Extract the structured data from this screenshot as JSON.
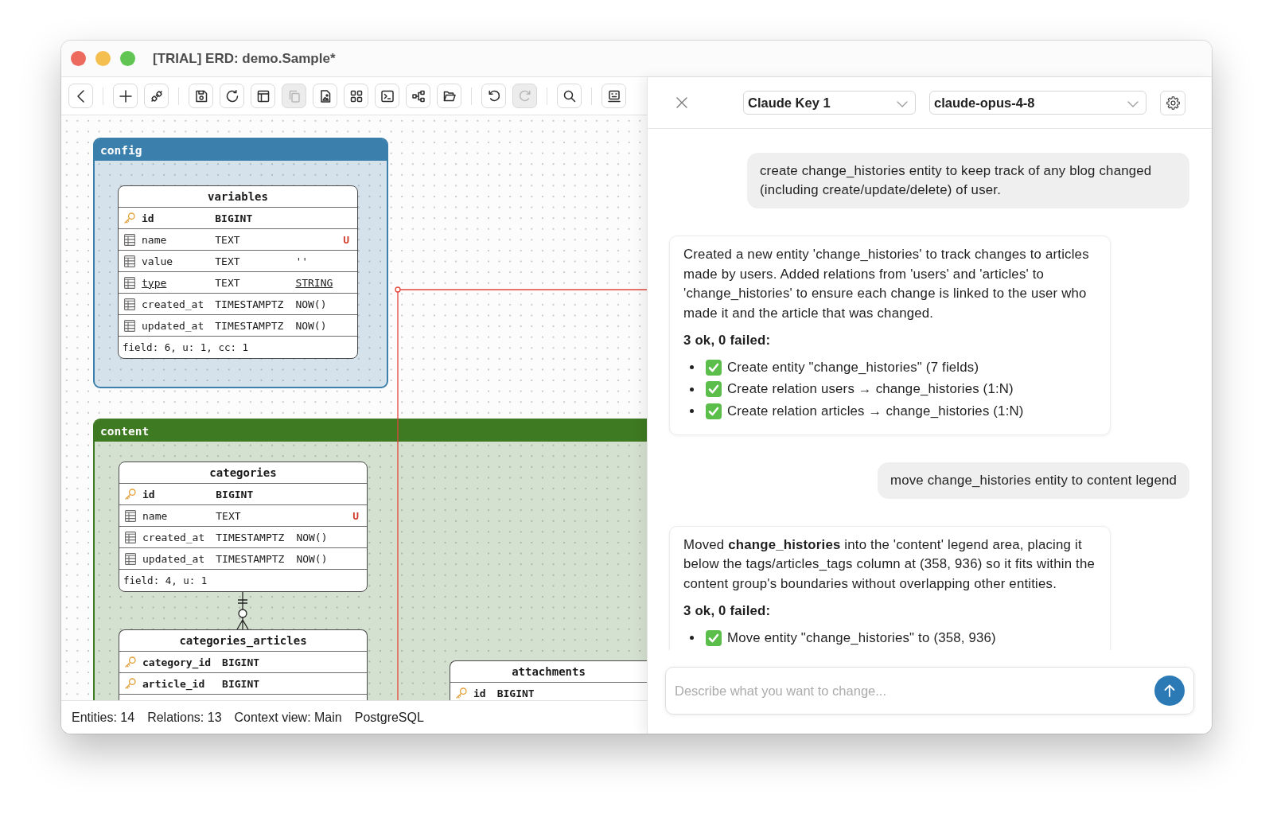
{
  "window": {
    "title": "[TRIAL] ERD: demo.Sample*"
  },
  "toolbar": {
    "groups": [
      {
        "items": [
          {
            "kind": "back",
            "disabled": false
          }
        ]
      },
      {
        "items": [
          {
            "kind": "add",
            "disabled": false
          },
          {
            "kind": "connect",
            "disabled": false
          }
        ]
      },
      {
        "items": [
          {
            "kind": "save",
            "disabled": false
          },
          {
            "kind": "refresh",
            "disabled": false
          },
          {
            "kind": "layout",
            "disabled": false
          },
          {
            "kind": "copy",
            "disabled": true
          },
          {
            "kind": "image",
            "disabled": false
          },
          {
            "kind": "grid",
            "disabled": false
          },
          {
            "kind": "terminal",
            "disabled": false
          },
          {
            "kind": "diagram",
            "disabled": false
          },
          {
            "kind": "folder",
            "disabled": false
          }
        ]
      },
      {
        "items": [
          {
            "kind": "undo",
            "disabled": false
          },
          {
            "kind": "redo",
            "disabled": true
          }
        ]
      },
      {
        "items": [
          {
            "kind": "search",
            "disabled": false
          }
        ]
      },
      {
        "items": [
          {
            "kind": "screen",
            "disabled": false
          }
        ]
      }
    ]
  },
  "canvas": {
    "groups": [
      {
        "name": "config",
        "color": "#3b7fac",
        "tables": [
          {
            "name": "variables",
            "fields": [
              {
                "kind": "primary",
                "name": "id",
                "type": "BIGINT",
                "underlined": false
              },
              {
                "kind": "column",
                "name": "name",
                "type": "TEXT",
                "flag": "U",
                "underlined": false
              },
              {
                "kind": "column",
                "name": "value",
                "type": "TEXT",
                "default": "''",
                "underlined": false
              },
              {
                "kind": "column",
                "name": "type",
                "type": "TEXT",
                "default": "STRING",
                "underlined": true
              },
              {
                "kind": "column",
                "name": "created_at",
                "type": "TIMESTAMPTZ",
                "default": "NOW()",
                "underlined": false
              },
              {
                "kind": "column",
                "name": "updated_at",
                "type": "TIMESTAMPTZ",
                "default": "NOW()",
                "underlined": false
              }
            ],
            "footer": "field: 6, u: 1, cc: 1"
          }
        ]
      },
      {
        "name": "content",
        "color": "#3e7a22",
        "tables": [
          {
            "name": "categories",
            "fields": [
              {
                "kind": "primary",
                "name": "id",
                "type": "BIGINT",
                "underlined": false
              },
              {
                "kind": "column",
                "name": "name",
                "type": "TEXT",
                "flag": "U",
                "underlined": false
              },
              {
                "kind": "column",
                "name": "created_at",
                "type": "TIMESTAMPTZ",
                "default": "NOW()",
                "underlined": false
              },
              {
                "kind": "column",
                "name": "updated_at",
                "type": "TIMESTAMPTZ",
                "default": "NOW()",
                "underlined": false
              }
            ],
            "footer": "field: 4, u: 1"
          },
          {
            "name": "categories_articles",
            "fields": [
              {
                "kind": "primary",
                "name": "category_id",
                "type": "BIGINT",
                "underlined": false
              },
              {
                "kind": "primary",
                "name": "article_id",
                "type": "BIGINT",
                "underlined": false
              }
            ]
          },
          {
            "name": "attachments",
            "fields": [
              {
                "kind": "primary",
                "name": "id",
                "type": "BIGINT",
                "underlined": false
              }
            ]
          }
        ]
      }
    ]
  },
  "status_bar": {
    "items": [
      "Entities: 14",
      "Relations: 13",
      "Context view: Main",
      "PostgreSQL"
    ]
  },
  "assistant_panel": {
    "api_key": {
      "value": "Claude Key 1"
    },
    "model": {
      "value": "claude-opus-4-8"
    },
    "messages": [
      {
        "kind": "user",
        "text": "create change_histories entity to keep track of any blog changed (including create/update/delete) of user."
      },
      {
        "kind": "assistant",
        "text": "Created a new entity 'change_histories' to track changes to articles made by users. Added relations from 'users' and 'articles' to 'change_histories' to ensure each change is linked to the user who made it and the article that was changed.",
        "summary": "3 ok, 0 failed:",
        "steps": [
          {
            "text": "Create entity \"change_histories\" (7 fields)",
            "ok": true
          },
          {
            "text": "Create relation users → change_histories (1:N)",
            "ok": true
          },
          {
            "text": "Create relation articles → change_histories (1:N)",
            "ok": true
          }
        ]
      },
      {
        "kind": "user",
        "text": "move change_histories entity to content legend"
      },
      {
        "kind": "assistant",
        "text": "Moved **change_histories** into the 'content' legend area, placing it below the tags/articles_tags column at (358, 936) so it fits within the content group's boundaries without overlapping other entities.",
        "summary": "3 ok, 0 failed:",
        "steps": [
          {
            "text": "Move entity \"change_histories\" to (358, 936)",
            "ok": true
          }
        ]
      }
    ],
    "input": {
      "placeholder": "Describe what you want to change..."
    }
  }
}
